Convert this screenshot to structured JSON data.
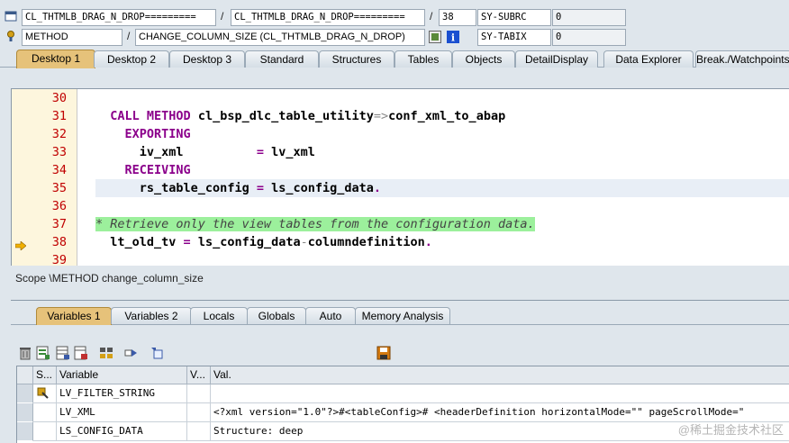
{
  "header": {
    "row1": {
      "program_field": "CL_THTMLB_DRAG_N_DROP=========",
      "sep1": "/",
      "include_field": "CL_THTMLB_DRAG_N_DROP=========",
      "sep2": "/",
      "line_field": "38",
      "sysvar_name": "SY-SUBRC",
      "sysvar_value": "0"
    },
    "row2": {
      "event_type": "METHOD",
      "sep": "/",
      "event_name": "CHANGE_COLUMN_SIZE (CL_THTMLB_DRAG_N_DROP)",
      "sysvar_name": "SY-TABIX",
      "sysvar_value": "0"
    }
  },
  "tabs": [
    {
      "label": "Desktop 1",
      "active": true
    },
    {
      "label": "Desktop 2"
    },
    {
      "label": "Desktop 3"
    },
    {
      "label": "Standard"
    },
    {
      "label": "Structures"
    },
    {
      "label": "Tables"
    },
    {
      "label": "Objects"
    },
    {
      "label": "DetailDisplay"
    },
    {
      "label": "Data Explorer"
    },
    {
      "label": "Break./Watchpoints"
    }
  ],
  "code": {
    "lines": [
      {
        "no": "30"
      },
      {
        "no": "31",
        "parts": [
          {
            "t": "CALL METHOD ",
            "c": "kw"
          },
          {
            "t": "cl_bsp_dlc_table_utility"
          },
          {
            "t": "=>",
            "c": "op"
          },
          {
            "t": "conf_xml_to_abap"
          }
        ],
        "indent": "  "
      },
      {
        "no": "32",
        "parts": [
          {
            "t": "EXPORTING",
            "c": "kw"
          }
        ],
        "indent": "    "
      },
      {
        "no": "33",
        "parts": [
          {
            "t": "iv_xml          "
          },
          {
            "t": "= ",
            "c": "kw"
          },
          {
            "t": "lv_xml"
          }
        ],
        "indent": "      "
      },
      {
        "no": "34",
        "parts": [
          {
            "t": "RECEIVING",
            "c": "kw"
          }
        ],
        "indent": "    "
      },
      {
        "no": "35",
        "parts": [
          {
            "t": "rs_table_config "
          },
          {
            "t": "= ",
            "c": "kw"
          },
          {
            "t": "ls_config_data"
          },
          {
            "t": ".",
            "c": "kw"
          }
        ],
        "indent": "      ",
        "highlight": true
      },
      {
        "no": "36"
      },
      {
        "no": "37",
        "parts": [
          {
            "t": "* Retrieve only the view tables from the configuration data.",
            "c": "cmt"
          }
        ],
        "indent": ""
      },
      {
        "no": "38",
        "parts": [
          {
            "t": "lt_old_tv "
          },
          {
            "t": "= ",
            "c": "kw"
          },
          {
            "t": "ls_config_data"
          },
          {
            "t": "-",
            "c": "op"
          },
          {
            "t": "columndefinition"
          },
          {
            "t": ".",
            "c": "kw"
          }
        ],
        "indent": "  ",
        "current": true
      },
      {
        "no": "39"
      }
    ]
  },
  "scope_text": "Scope \\METHOD change_column_size",
  "var_tabs": [
    {
      "label": "Variables 1",
      "active": true
    },
    {
      "label": "Variables 2"
    },
    {
      "label": "Locals"
    },
    {
      "label": "Globals"
    },
    {
      "label": "Auto"
    },
    {
      "label": "Memory Analysis"
    }
  ],
  "toolbar_icons": [
    "delete-icon",
    "insert-icon",
    "table-icon",
    "export-icon",
    "grid-icon",
    "transfer-icon",
    "object-icon"
  ],
  "save_icon": "save-icon",
  "grid": {
    "columns": [
      "S...",
      "Variable",
      "V...",
      "Val."
    ],
    "rows": [
      {
        "variable": "LV_FILTER_STRING",
        "value": "",
        "icon": "arrow-icon"
      },
      {
        "variable": "LV_XML",
        "value": "<?xml version=\"1.0\"?>#<tableConfig>#  <headerDefinition horizontalMode=\"\" pageScrollMode=\""
      },
      {
        "variable": "LS_CONFIG_DATA",
        "value": "Structure: deep"
      }
    ]
  },
  "watermark": "@稀土掘金技术社区",
  "colors": {
    "active_tab": "#e6c27a",
    "comment_bg": "#9cf09c",
    "keyword": "#8b008b",
    "line_number": "#c00000",
    "current_line_arrow": "#f0b000"
  }
}
